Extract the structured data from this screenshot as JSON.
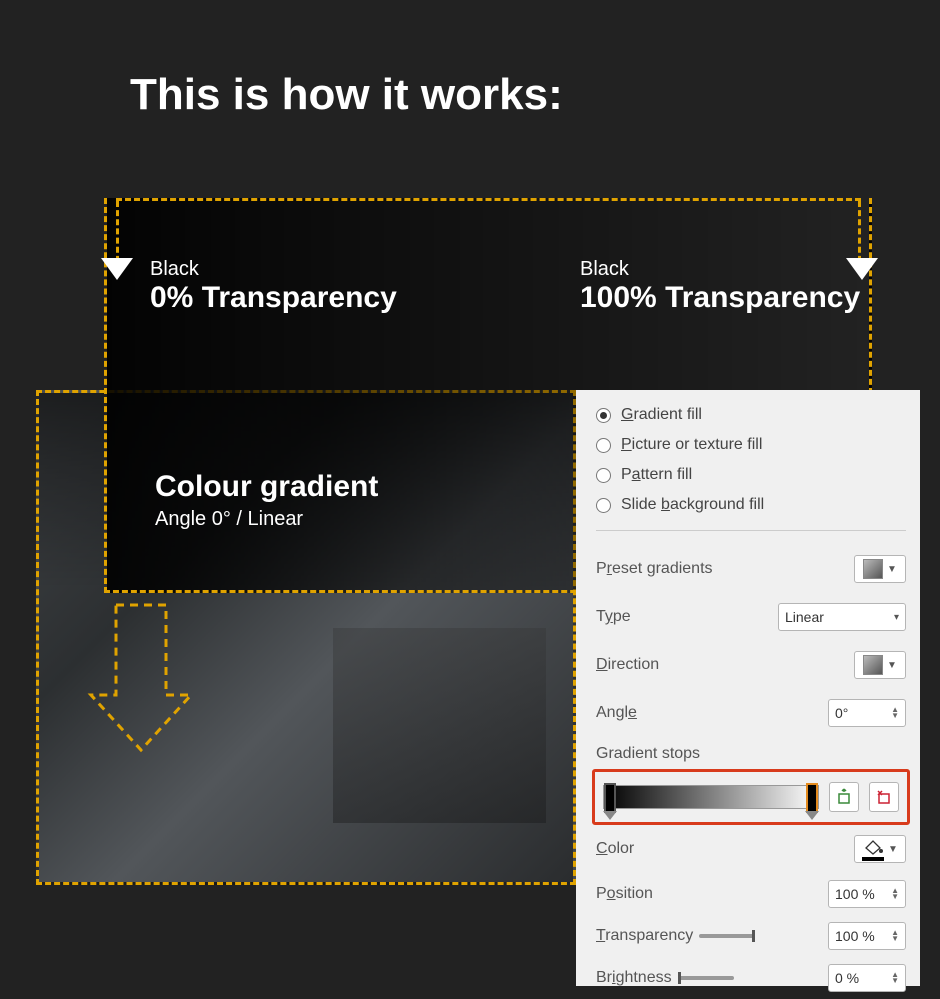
{
  "title": "This is how it works:",
  "stop1": {
    "color": "Black",
    "transparency": "0% Transparency"
  },
  "stop2": {
    "color": "Black",
    "transparency": "100% Transparency"
  },
  "gradient_desc": {
    "title": "Colour gradient",
    "sub": "Angle 0° / Linear"
  },
  "panel": {
    "fill_options": {
      "gradient": "Gradient fill",
      "picture": "Picture or texture fill",
      "pattern": "Pattern fill",
      "slidebg": "Slide background fill"
    },
    "preset_label": "Preset gradients",
    "type_label": "Type",
    "type_value": "Linear",
    "direction_label": "Direction",
    "angle_label": "Angle",
    "angle_value": "0°",
    "stops_label": "Gradient stops",
    "color_label": "Color",
    "position_label": "Position",
    "position_value": "100 %",
    "transparency_label": "Transparency",
    "transparency_value": "100 %",
    "brightness_label": "Brightness",
    "brightness_value": "0 %"
  }
}
